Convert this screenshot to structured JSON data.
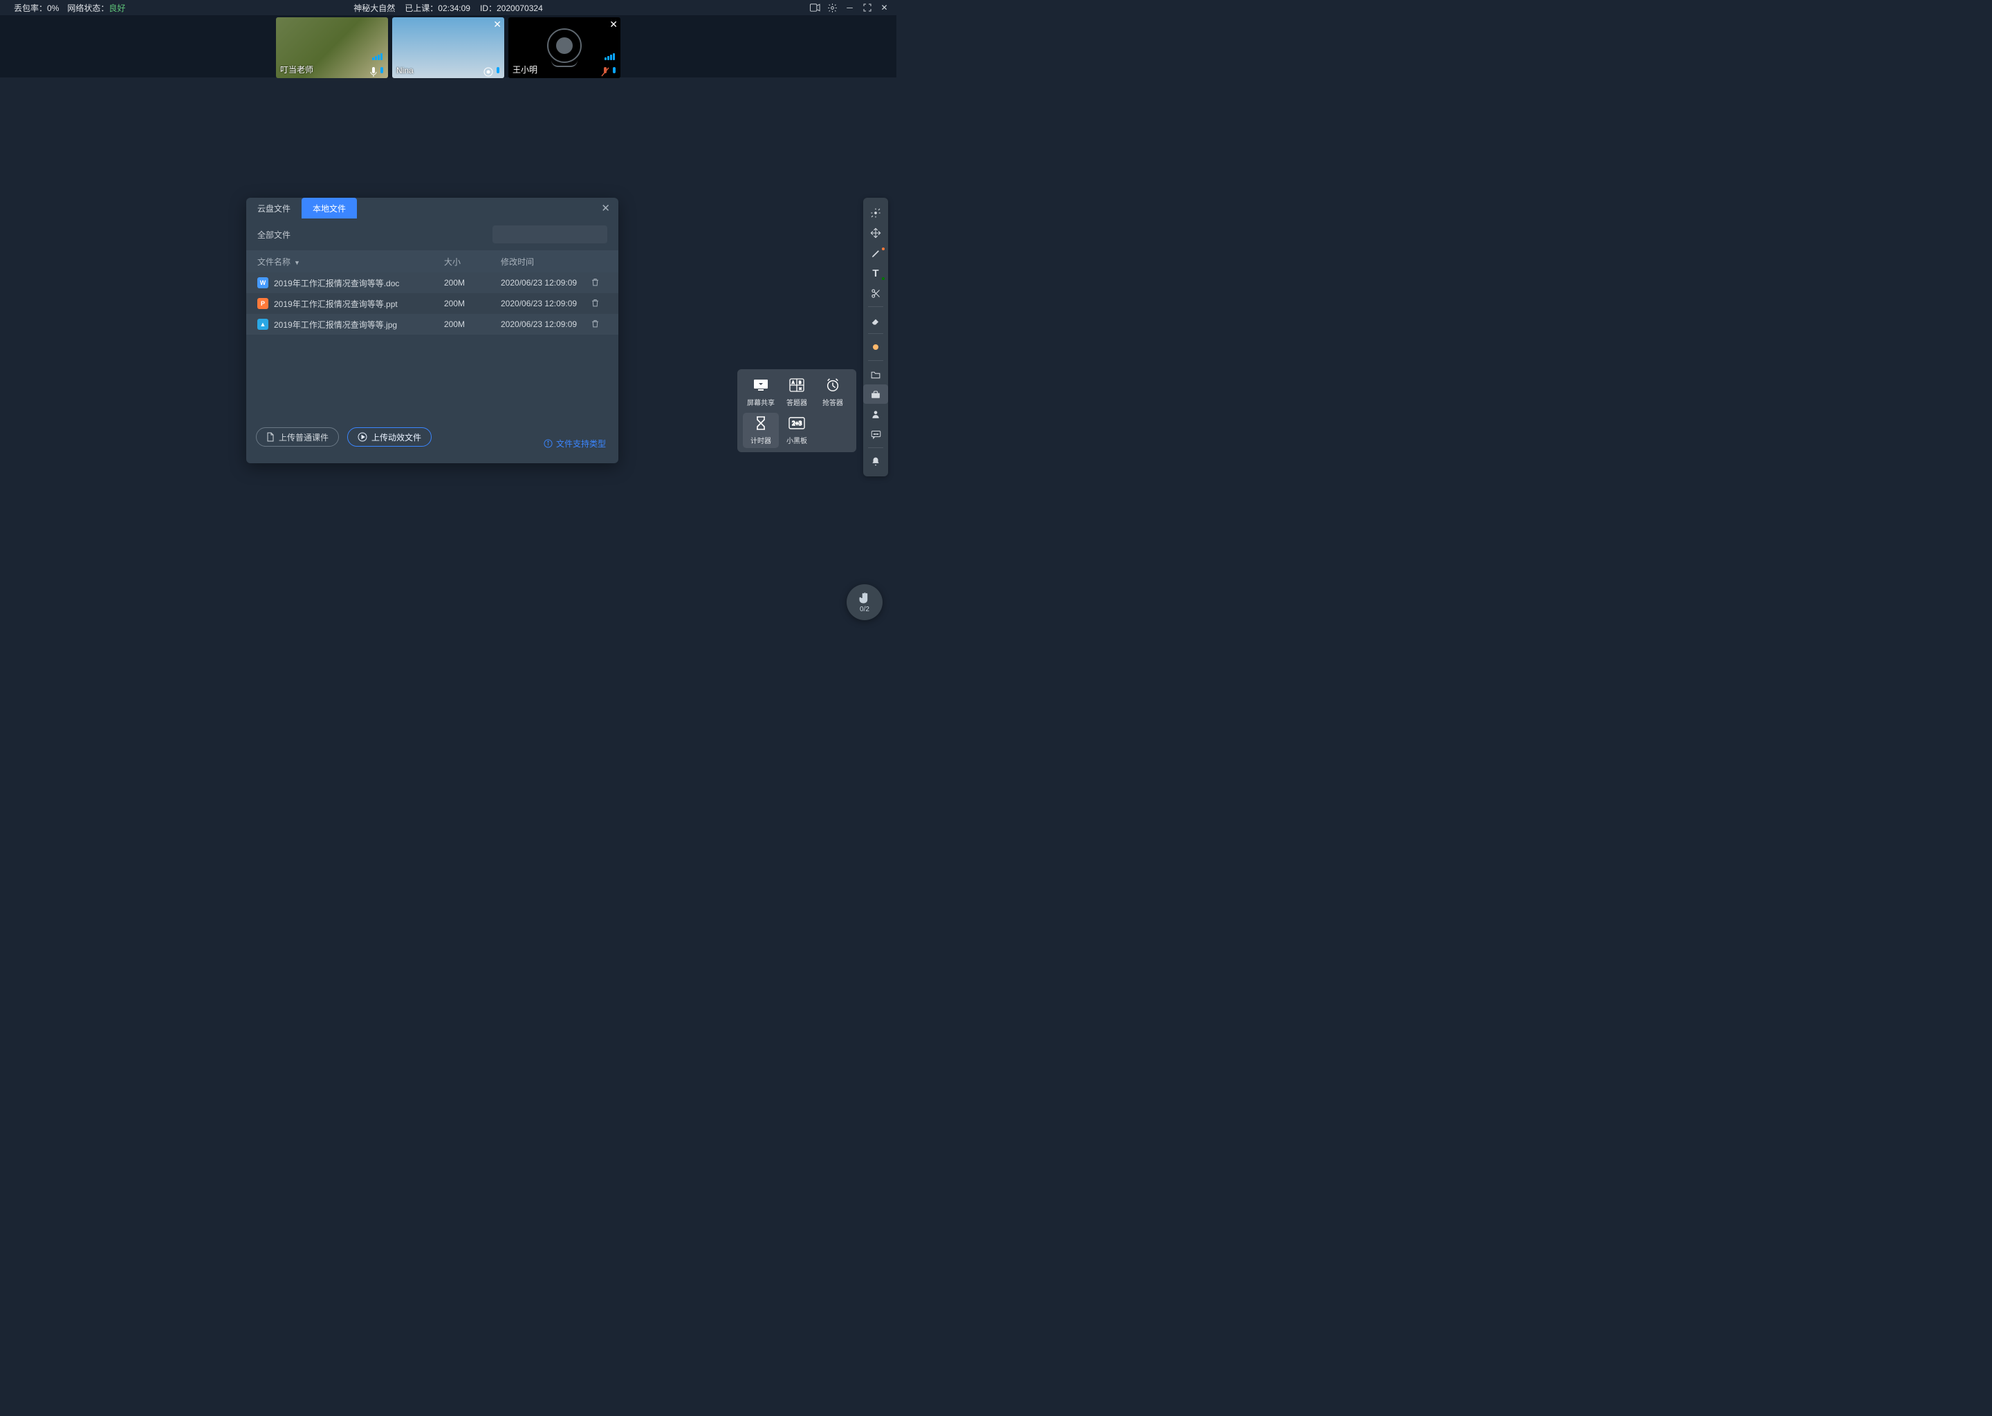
{
  "topbar": {
    "packet_loss_label": "丢包率：",
    "packet_loss_value": "0%",
    "network_label": "网络状态：",
    "network_value": "良好",
    "title": "神秘大自然",
    "class_label": "已上课：",
    "class_value": "02:34:09",
    "id_label": "ID：",
    "id_value": "2020070324"
  },
  "participants": [
    {
      "name": "叮当老师",
      "camera_off": false,
      "close": false,
      "mic_muted": false
    },
    {
      "name": "Nina",
      "camera_off": false,
      "close": true,
      "mic_muted": false
    },
    {
      "name": "王小明",
      "camera_off": true,
      "close": true,
      "mic_muted": true
    }
  ],
  "dialog": {
    "tab_cloud": "云盘文件",
    "tab_local": "本地文件",
    "toolbar_label": "全部文件",
    "columns": {
      "name": "文件名称",
      "size": "大小",
      "mtime": "修改时间"
    },
    "files": [
      {
        "icon": "doc",
        "badge": "W",
        "name": "2019年工作汇报情况查询等等.doc",
        "size": "200M",
        "mtime": "2020/06/23 12:09:09"
      },
      {
        "icon": "ppt",
        "badge": "P",
        "name": "2019年工作汇报情况查询等等.ppt",
        "size": "200M",
        "mtime": "2020/06/23 12:09:09"
      },
      {
        "icon": "img",
        "badge": "▲",
        "name": "2019年工作汇报情况查询等等.jpg",
        "size": "200M",
        "mtime": "2020/06/23 12:09:09"
      }
    ],
    "upload_normal": "上传普通课件",
    "upload_anim": "上传动效文件",
    "support_text": "文件支持类型"
  },
  "tools": {
    "screen_share": "屏幕共享",
    "answer": "答题器",
    "buzzer": "抢答器",
    "timer": "计时器",
    "blackboard": "小黑板"
  },
  "hand": {
    "label": "0/2"
  }
}
